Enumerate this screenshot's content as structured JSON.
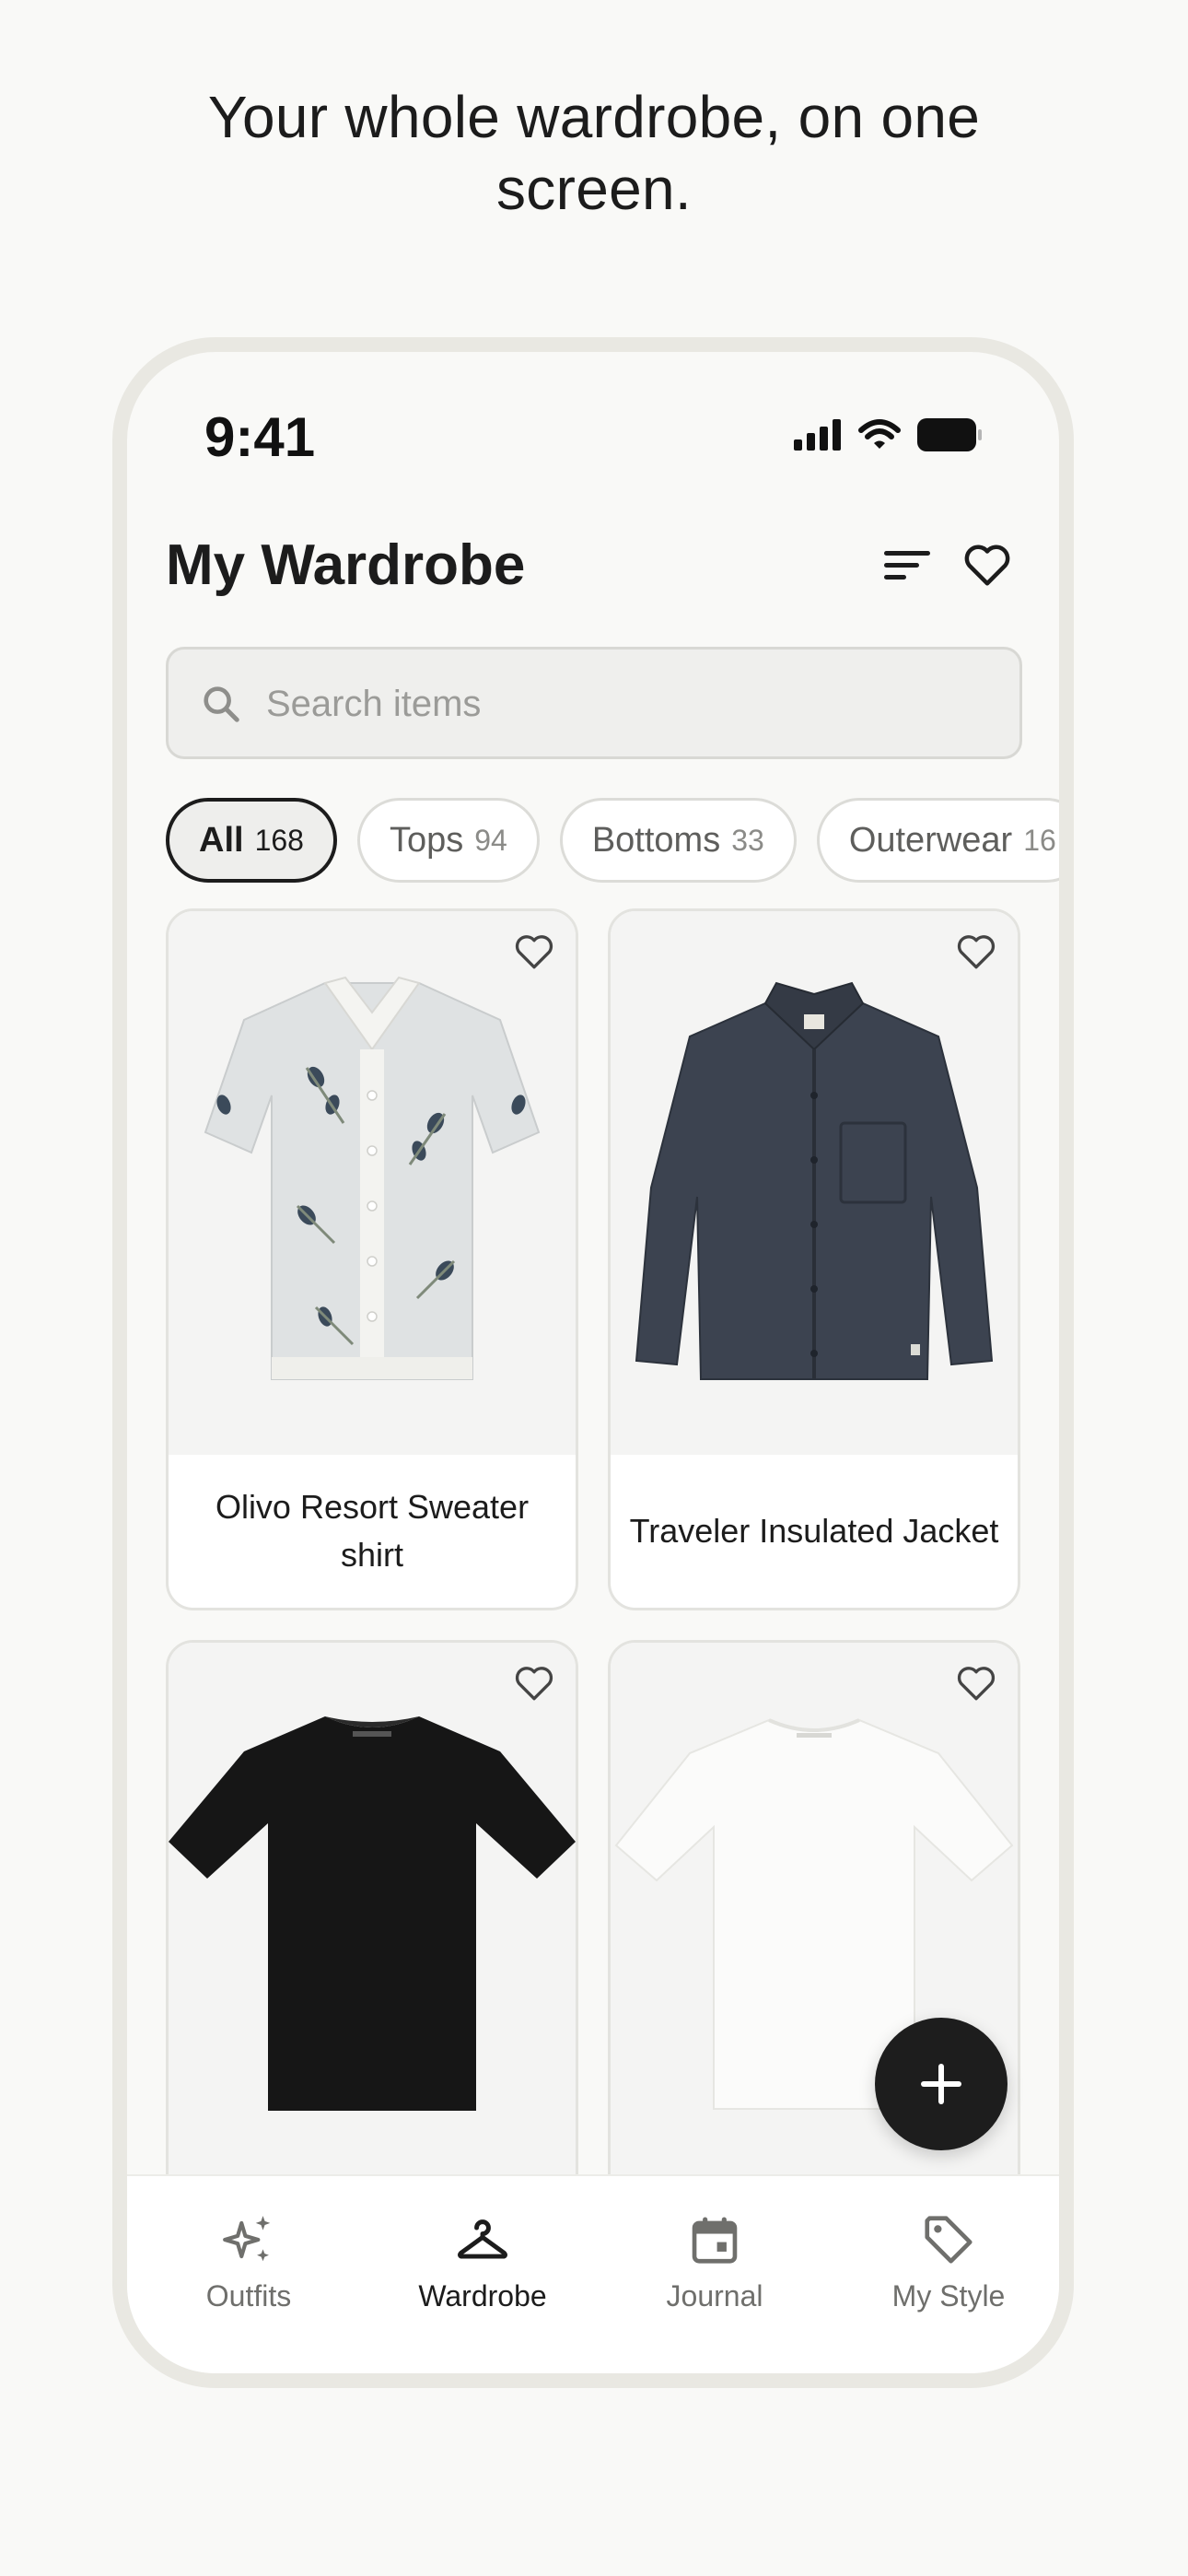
{
  "headline": {
    "line1": "Your whole wardrobe, on one",
    "line2": "screen."
  },
  "status_bar": {
    "time": "9:41"
  },
  "header": {
    "title": "My Wardrobe",
    "filter_icon": "sort-filter-icon",
    "favorites_icon": "heart-icon"
  },
  "search": {
    "placeholder": "Search items",
    "value": "",
    "icon": "search-icon"
  },
  "filters": [
    {
      "label": "All",
      "count": "168",
      "active": true
    },
    {
      "label": "Tops",
      "count": "94",
      "active": false
    },
    {
      "label": "Bottoms",
      "count": "33",
      "active": false
    },
    {
      "label": "Outerwear",
      "count": "16",
      "active": false
    }
  ],
  "items": [
    {
      "name": "Olivo Resort Sweater shirt",
      "image": "olive-print-knit-shirt",
      "favorited": false
    },
    {
      "name": "Traveler Insulated Jacket",
      "image": "navy-insulated-jacket",
      "favorited": false
    },
    {
      "name": "",
      "image": "black-tshirt",
      "favorited": false
    },
    {
      "name": "",
      "image": "white-tshirt",
      "favorited": false
    }
  ],
  "fab": {
    "icon": "plus-icon"
  },
  "tabs": [
    {
      "label": "Outfits",
      "icon": "sparkles-icon",
      "active": false
    },
    {
      "label": "Wardrobe",
      "icon": "hanger-icon",
      "active": true
    },
    {
      "label": "Journal",
      "icon": "calendar-icon",
      "active": false
    },
    {
      "label": "My Style",
      "icon": "tag-icon",
      "active": false
    }
  ],
  "colors": {
    "background": "#f9f9f7",
    "accent": "#1c1c1c",
    "frame": "#e9e8e2"
  }
}
